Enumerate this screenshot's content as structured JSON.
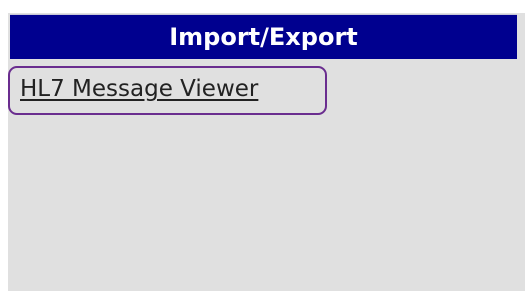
{
  "panel": {
    "title": "Import/Export",
    "links": [
      {
        "label": "HL7 Message Viewer"
      }
    ]
  },
  "colors": {
    "header_bg": "#00008f",
    "header_text": "#ffffff",
    "panel_bg": "#e0e0e0",
    "highlight_border": "#6a2d8f"
  }
}
